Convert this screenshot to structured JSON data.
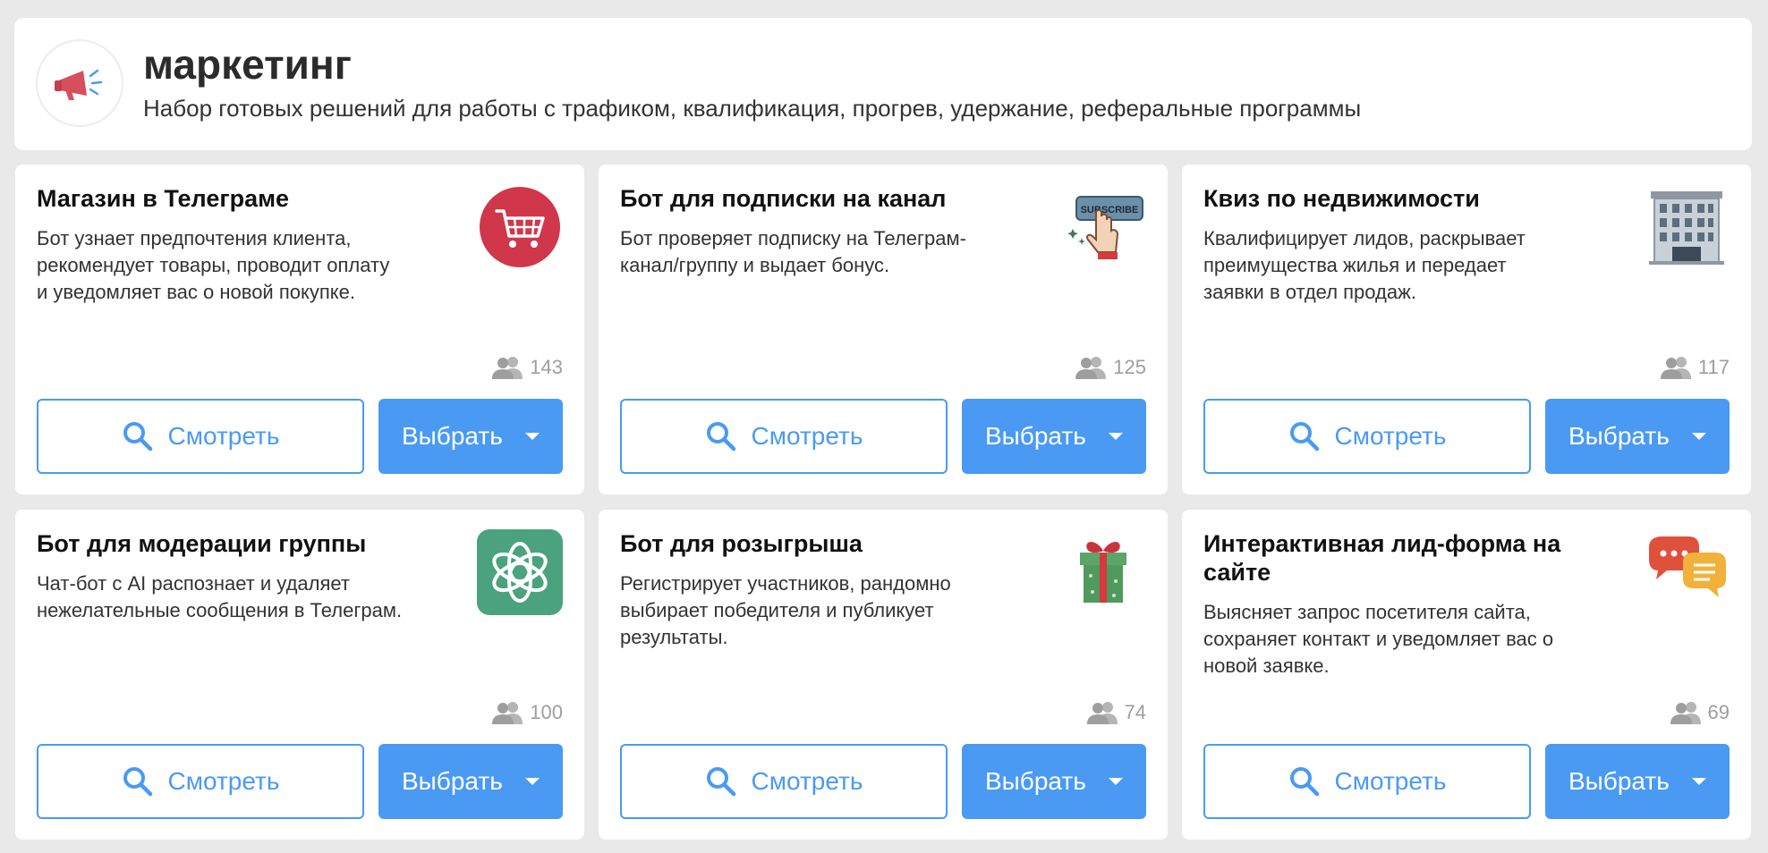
{
  "header": {
    "title": "маркетинг",
    "subtitle": "Набор готовых решений для работы с трафиком, квалификация, прогрев, удержание, реферальные программы",
    "icon": "megaphone-icon"
  },
  "buttons": {
    "view_label": "Смотреть",
    "choose_label": "Выбрать"
  },
  "cards": [
    {
      "title": "Магазин в Телеграме",
      "desc_lines": [
        "Бот узнает предпочтения клиента,",
        "рекомендует товары, проводит оплату",
        "и уведомляет вас о новой покупке."
      ],
      "users": "143",
      "icon": "shopping-cart-icon"
    },
    {
      "title": "Бот для подписки на канал",
      "desc_lines": [
        "Бот проверяет подписку на Телеграм-",
        "канал/группу и выдает бонус."
      ],
      "users": "125",
      "icon": "subscribe-button-icon",
      "icon_text": "SUBSCRIBE"
    },
    {
      "title": "Квиз по недвижимости",
      "desc_lines": [
        "Квалифицирует лидов, раскрывает",
        "преимущества жилья и передает",
        "заявки в отдел продаж."
      ],
      "users": "117",
      "icon": "office-building-icon"
    },
    {
      "title": "Бот для модерации группы",
      "desc_lines": [
        "Чат-бот с AI распознает и удаляет",
        "нежелательные сообщения в Телеграм."
      ],
      "users": "100",
      "icon": "openai-logo-icon"
    },
    {
      "title": "Бот для розыгрыша",
      "desc_lines": [
        "Регистрирует участников, рандомно",
        "выбирает победителя и публикует",
        "результаты."
      ],
      "users": "74",
      "icon": "gift-box-icon"
    },
    {
      "title_lines": [
        "Интерактивная лид-форма на",
        "сайте"
      ],
      "desc_lines": [
        "Выясняет запрос посетителя сайта,",
        "сохраняет контакт и уведомляет вас о",
        "новой заявке."
      ],
      "users": "69",
      "icon": "chat-bubbles-icon"
    }
  ],
  "colors": {
    "accent": "#4a9af4",
    "background": "#e9e9e9",
    "card": "#ffffff",
    "muted": "#9e9e9e"
  }
}
